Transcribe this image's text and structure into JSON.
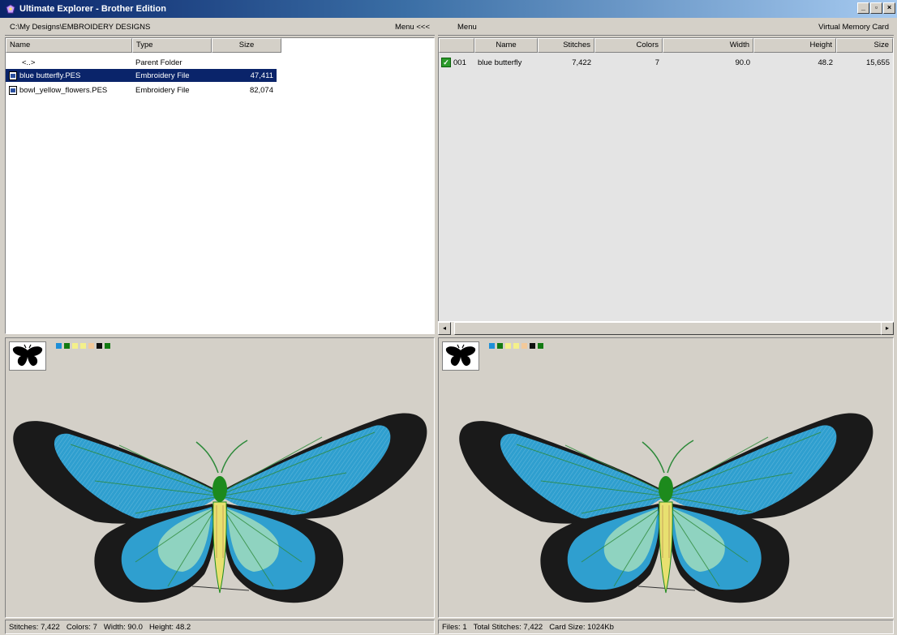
{
  "window": {
    "title": "Ultimate Explorer - Brother Edition",
    "controls": [
      "_",
      "▫",
      "×"
    ]
  },
  "left_panel": {
    "path": "C:\\My Designs\\EMBROIDERY DESIGNS",
    "menu_label": "Menu <<<",
    "columns": [
      "Name",
      "Type",
      "Size"
    ],
    "rows": [
      {
        "name": "<..>",
        "type": "Parent Folder",
        "size": "",
        "icon": "none",
        "selected": false
      },
      {
        "name": "blue butterfly.PES",
        "type": "Embroidery File",
        "size": "47,411",
        "icon": "file-icon",
        "selected": true
      },
      {
        "name": "bowl_yellow_flowers.PES",
        "type": "Embroidery File",
        "size": "82,074",
        "icon": "file-icon",
        "selected": false
      }
    ]
  },
  "right_panel": {
    "menu_label": "Menu",
    "card_label": "Virtual Memory Card",
    "columns": [
      "",
      "Name",
      "Stitches",
      "Colors",
      "Width",
      "Height",
      "Size"
    ],
    "rows": [
      {
        "index": "001",
        "name": "blue butterfly",
        "stitches": "7,422",
        "colors": "7",
        "width": "90.0",
        "height": "48.2",
        "size": "15,655",
        "icon": "check-icon"
      }
    ]
  },
  "preview": {
    "thumbnail_icon": "butterfly-silhouette-icon",
    "swatch_colors": [
      "#1e8fd8",
      "#127a12",
      "#f4f08a",
      "#f4f08a",
      "#f3c99a",
      "#101010",
      "#127a12"
    ],
    "palette": {
      "wing_black": "#1a1a1a",
      "wing_blue": "#2f9fcf",
      "wing_light": "#8fd3c0",
      "body_green": "#1d8a1d",
      "body_yellow": "#e8e070",
      "vein_green": "#2d8a3a"
    }
  },
  "left_status": {
    "stitches": "Stitches: 7,422",
    "colors": "Colors: 7",
    "width": "Width: 90.0",
    "height": "Height: 48.2"
  },
  "right_status": {
    "files": "Files: 1",
    "total_stitches": "Total Stitches: 7,422",
    "card_size": "Card Size: 1024Kb"
  }
}
